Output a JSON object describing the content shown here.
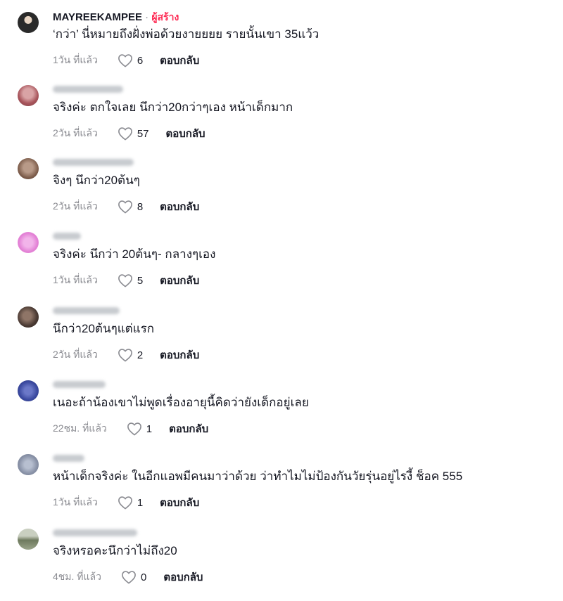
{
  "comments": [
    {
      "username": "MAYREEKAMPEE",
      "creator_sep": " · ",
      "creator_badge": "ผู้สร้าง",
      "text": "‘กว่า’ นี่หมายถึงฝั่งพ่อด้วยงายยยย รายนั้นเขา 35แว้ว",
      "time": "1วัน ที่แล้ว",
      "likes": "6",
      "reply": "ตอบกลับ",
      "avatar_color": "#3a3a3a",
      "username_blurred": false
    },
    {
      "username": "",
      "text": "จริงค่ะ ตกใจเลย นึกว่า20กว่าๆเอง หน้าเด็กมาก",
      "time": "2วัน ที่แล้ว",
      "likes": "57",
      "reply": "ตอบกลับ",
      "avatar_color": "#b0686c",
      "username_blurred": true
    },
    {
      "username": "",
      "text": "จิงๆ นึกว่า20ต้นๆ",
      "time": "2วัน ที่แล้ว",
      "likes": "8",
      "reply": "ตอบกลับ",
      "avatar_color": "#8a6a58",
      "username_blurred": true
    },
    {
      "username": "",
      "text": "จริงค่ะ นึกว่า 20ต้นๆ- กลางๆเอง",
      "time": "1วัน ที่แล้ว",
      "likes": "5",
      "reply": "ตอบกลับ",
      "avatar_color": "#e58ad8",
      "username_blurred": true
    },
    {
      "username": "",
      "text": "นึกว่า20ต้นๆแต่แรก",
      "time": "2วัน ที่แล้ว",
      "likes": "2",
      "reply": "ตอบกลับ",
      "avatar_color": "#4a3a33",
      "username_blurred": true
    },
    {
      "username": "",
      "text": "เนอะถ้าน้องเขาไม่พูดเรื่องอายุนี้คิดว่ายังเด็กอยู่เลย",
      "time": "22ชม. ที่แล้ว",
      "likes": "1",
      "reply": "ตอบกลับ",
      "avatar_color": "#3b4aa0",
      "username_blurred": true
    },
    {
      "username": "",
      "text": "หน้าเด็กจริงค่ะ ในอีกแอพมีคนมาว่าด้วย ว่าทำไมไม่ป้องกันวัยรุ่นอยู่ไรงี้ ช็อค 555",
      "time": "1วัน ที่แล้ว",
      "likes": "1",
      "reply": "ตอบกลับ",
      "avatar_color": "#8a93a8",
      "username_blurred": true
    },
    {
      "username": "",
      "text": "จริงหรอคะนึกว่าไม่ถึง20",
      "time": "4ชม. ที่แล้ว",
      "likes": "0",
      "reply": "ตอบกลับ",
      "avatar_color": "#6e7a5e",
      "username_blurred": true
    }
  ]
}
